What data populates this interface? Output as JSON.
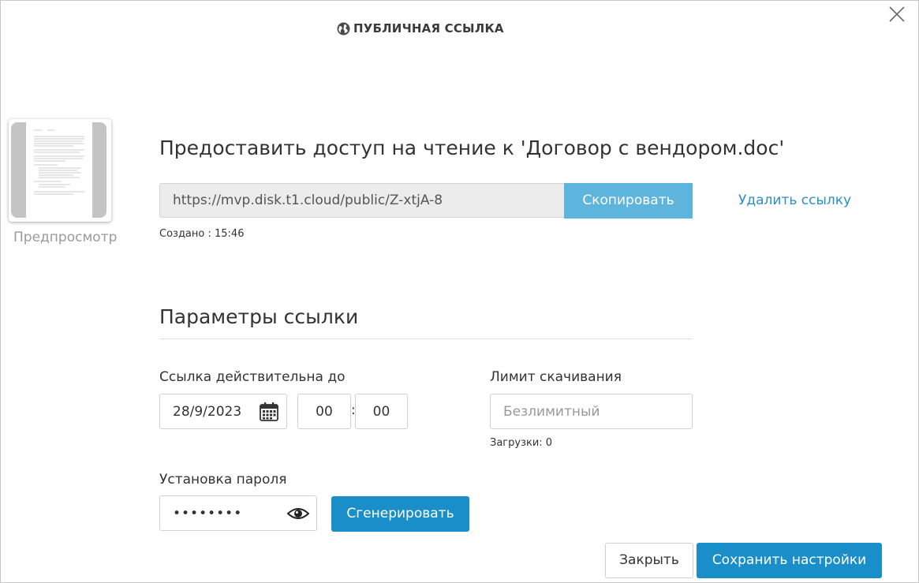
{
  "dialog": {
    "title": "ПУБЛИЧНАЯ ССЫЛКА",
    "title_icon": "globe-icon",
    "close_icon": "close-icon"
  },
  "preview": {
    "label": "Предпросмотр"
  },
  "share": {
    "heading": "Предоставить доступ на чтение к 'Договор с вендором.doc'",
    "url": "https://mvp.disk.t1.cloud/public/Z-xtjA-8",
    "copy_label": "Скопировать",
    "delete_label": "Удалить ссылку",
    "created": "Создано : 15:46"
  },
  "params": {
    "title": "Параметры ссылки",
    "valid_until_label": "Ссылка действительна до",
    "date_value": "28/9/2023",
    "hour_value": "00",
    "minute_value": "00",
    "time_separator": ":",
    "limit_label": "Лимит скачивания",
    "limit_placeholder": "Безлимитный",
    "downloads": "Загрузки: 0",
    "password_label": "Установка пароля",
    "password_value": "••••••••",
    "generate_label": "Сгенерировать"
  },
  "footer": {
    "close_label": "Закрыть",
    "save_label": "Сохранить настройки"
  },
  "colors": {
    "primary_button": "#1a8ec8",
    "copy_button": "#5db4dd",
    "link": "#2d8dc4"
  }
}
